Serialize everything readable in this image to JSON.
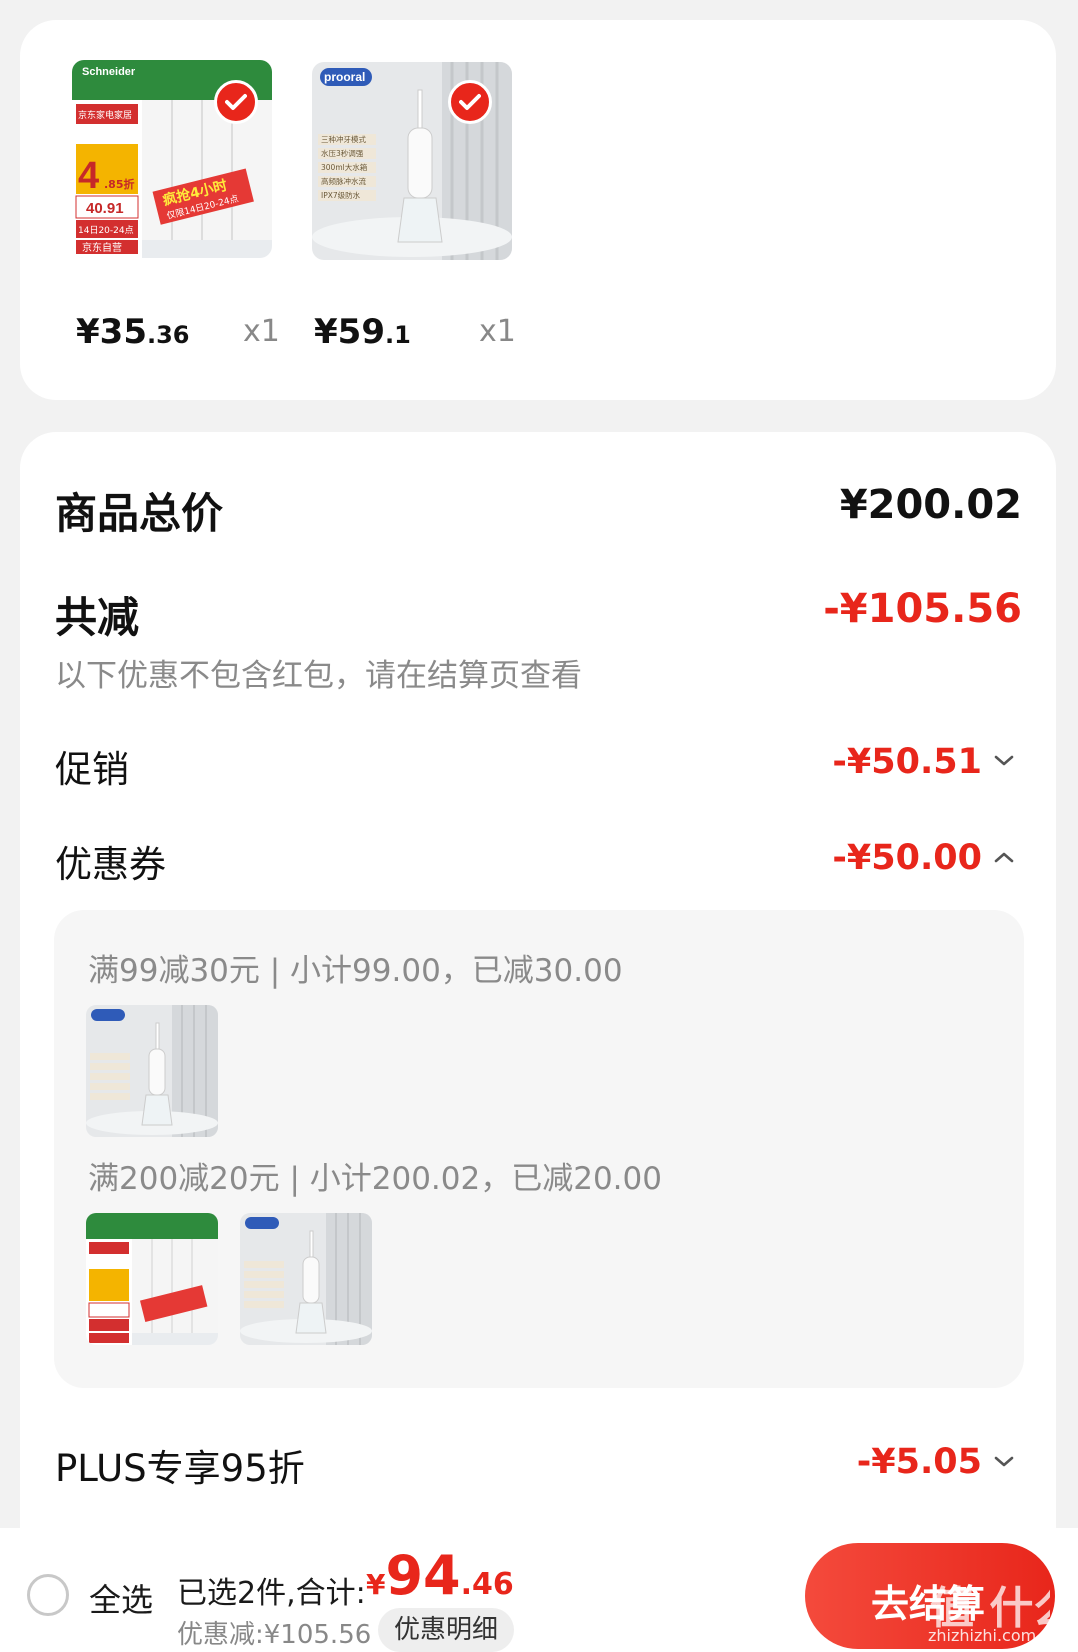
{
  "selected_items": [
    {
      "price_int": "¥35",
      "price_dec": ".36",
      "qty": "x1"
    },
    {
      "price_int": "¥59",
      "price_dec": ".1",
      "qty": "x1"
    }
  ],
  "product_images": {
    "switch": {
      "brand": "Schneider",
      "promo_title": "京东家电家居",
      "big_number": "4",
      "big_suffix": ".85折",
      "price_line": "40.91",
      "time_line": "14日20-24点",
      "store": "京东自营",
      "banner": "疯抢4小时",
      "banner_sub": "仅限14日20-24点"
    },
    "flosser": {
      "brand": "prooral",
      "features": [
        "三种冲牙模式",
        "水压3秒调强",
        "300ml大水箱",
        "高频脉冲水流",
        "IPX7级防水"
      ]
    }
  },
  "summary": {
    "total_label": "商品总价",
    "total_value": "¥200.02",
    "reduce_label": "共减",
    "reduce_value": "-¥105.56",
    "note": "以下优惠不包含红包，请在结算页查看",
    "promo_label": "促销",
    "promo_value": "-¥50.51",
    "coupon_label": "优惠券",
    "coupon_value": "-¥50.00",
    "plus_label": "PLUS专享95折",
    "plus_value": "-¥5.05"
  },
  "coupons": [
    {
      "text": "满99减30元 | 小计99.00，已减30.00"
    },
    {
      "text": "满200减20元 | 小计200.02，已减20.00"
    }
  ],
  "bottom": {
    "select_all": "全选",
    "selected_prefix": "已选2件,合计:",
    "total_symbol": "¥",
    "total_int": "94",
    "total_dec": ".46",
    "discount": "优惠减:¥105.56",
    "detail_btn": "优惠明细",
    "checkout": "去结算"
  },
  "watermark": {
    "text": "值 什么值得买",
    "url": "zhizhizhi.com"
  },
  "colors": {
    "accent": "#e8261b",
    "background": "#f2f2f2",
    "card": "#ffffff"
  }
}
